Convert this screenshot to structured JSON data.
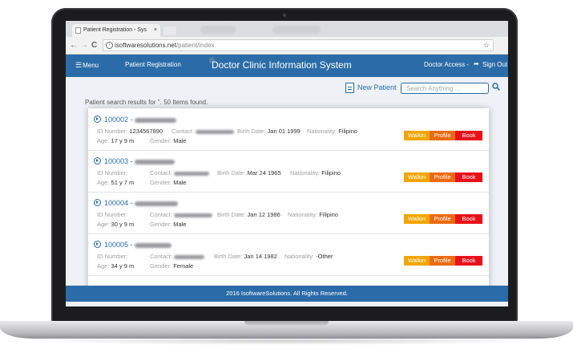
{
  "browser": {
    "tab_title": "Patient Registration - Sys",
    "tab_close": "×",
    "back": "←",
    "forward": "→",
    "reload": "C",
    "url_host": "isoftwaresolutions.net",
    "url_path": "/patient/index",
    "info": "i",
    "star": "☆"
  },
  "header": {
    "menu_icon": "☰",
    "menu_label": "Menu",
    "page_name": "Patient Registration",
    "app_title": "Doctor Clinic Information System",
    "access": "Doctor Access -",
    "signout_icon": "➦",
    "signout_label": "Sign Out"
  },
  "actions": {
    "new_patient": "New Patient",
    "search_placeholder": "Search Anything ..."
  },
  "results": {
    "summary": "Patient search results for ''. 50 Items found."
  },
  "labels": {
    "id_number": "ID Number:",
    "contact": "Contact:",
    "birth_date": "Birth Date:",
    "nationality": "Nationality:",
    "age": "Age:",
    "gender": "Gender:",
    "walkin": "Walkin",
    "profile": "Profile",
    "book": "Book"
  },
  "patients": [
    {
      "code": "100002 -",
      "id_number": "1234567890",
      "birth_date": "Jan 01 1999",
      "nationality": "Filipino",
      "age": "17 y 9 m",
      "gender": "Male"
    },
    {
      "code": "100003 -",
      "id_number": "",
      "birth_date": "Mar 24 1965",
      "nationality": "Filipino",
      "age": "51 y 7 m",
      "gender": "Male"
    },
    {
      "code": "100004 -",
      "id_number": "",
      "birth_date": "Jan 12 1986",
      "nationality": "Filipino",
      "age": "30 y 9 m",
      "gender": "Male"
    },
    {
      "code": "100005 -",
      "id_number": "",
      "birth_date": "Jan 14 1982",
      "nationality": "-Other",
      "age": "34 y 9 m",
      "gender": "Female"
    }
  ],
  "footer": {
    "copyright": "2016 IsoftwareSolutions. All Rights Reserved."
  },
  "colors": {
    "primary": "#2b6ca8",
    "walkin": "#f2a500",
    "profile": "#ec6a12",
    "book": "#e8111a"
  }
}
